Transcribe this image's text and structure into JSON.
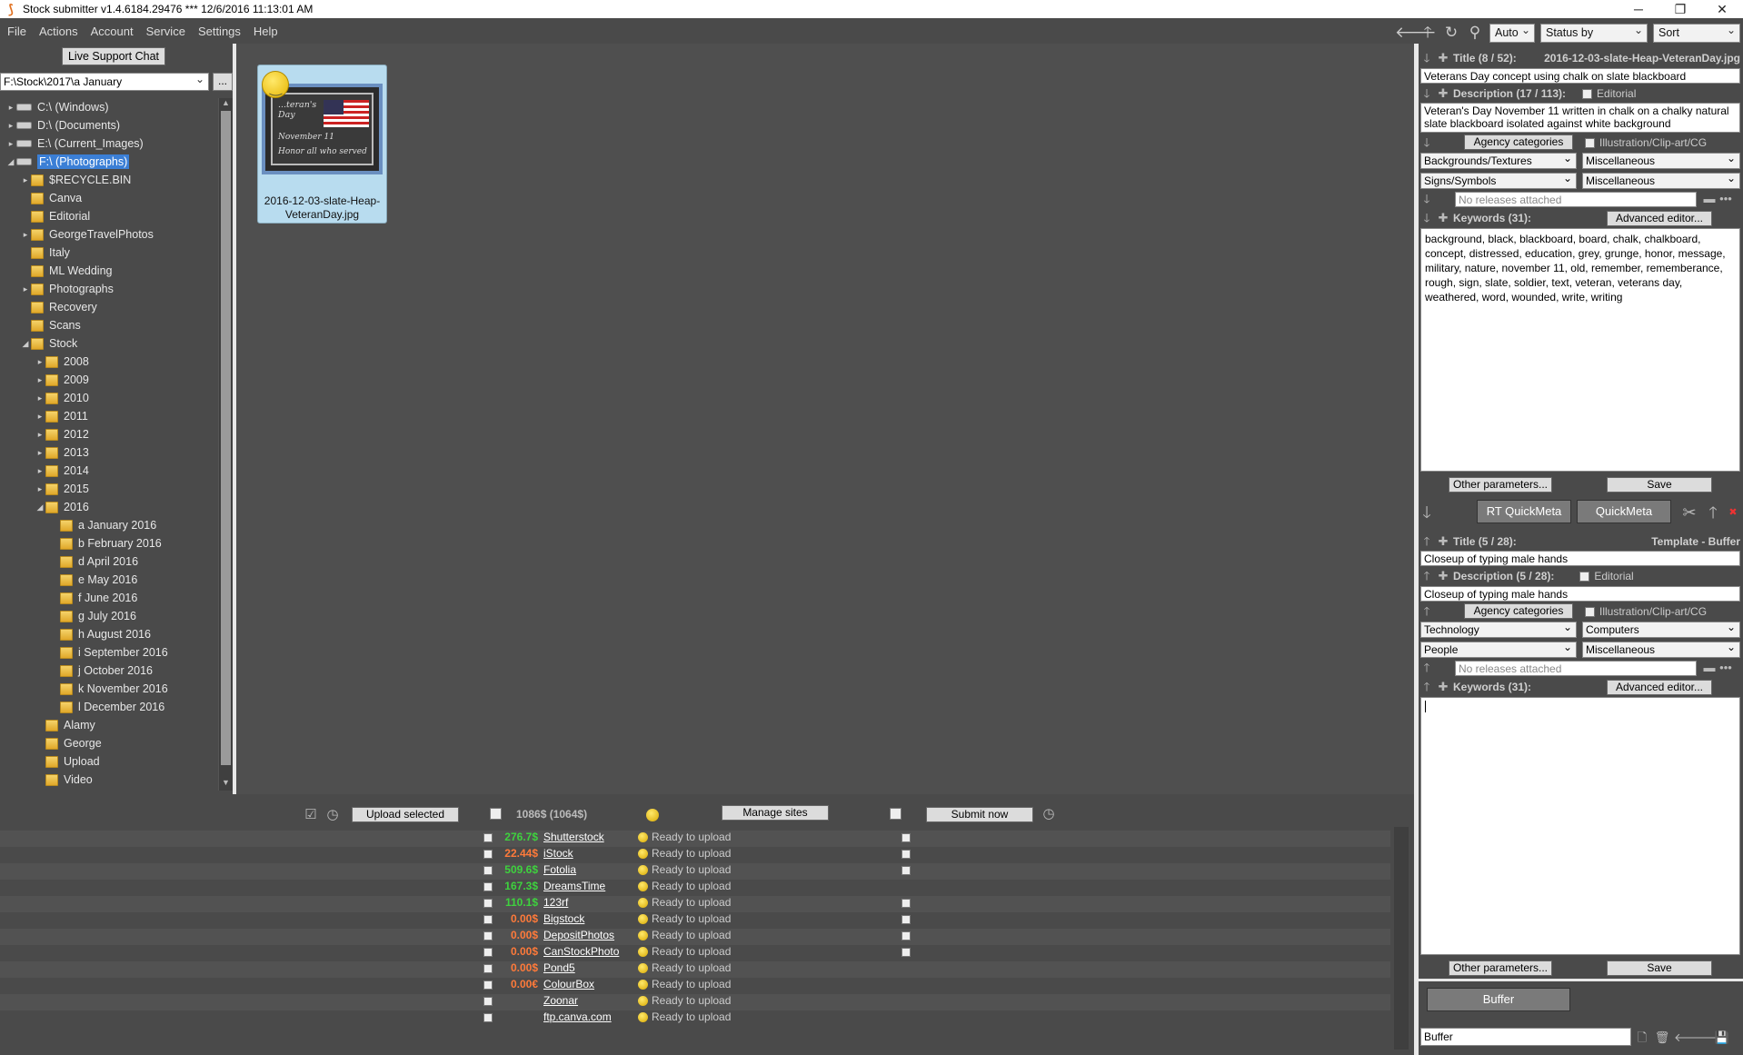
{
  "window": {
    "title": "Stock submitter v1.4.6184.29476 ***  12/6/2016 11:13:01 AM"
  },
  "menu": [
    "File",
    "Actions",
    "Account",
    "Service",
    "Settings",
    "Help"
  ],
  "toolbar": {
    "mode": "Auto",
    "status": "Status by agency",
    "sort": "Sort"
  },
  "left": {
    "live_chat": "Live Support Chat",
    "path": "F:\\Stock\\2017\\a January",
    "browse": "..."
  },
  "tree": [
    {
      "label": "C:\\ (Windows)",
      "type": "drive",
      "level": 0,
      "arrow": "▸"
    },
    {
      "label": "D:\\ (Documents)",
      "type": "drive",
      "level": 0,
      "arrow": "▸"
    },
    {
      "label": "E:\\ (Current_Images)",
      "type": "drive",
      "level": 0,
      "arrow": "▸"
    },
    {
      "label": "F:\\ (Photographs)",
      "type": "drive",
      "level": 0,
      "arrow": "◢",
      "selected": true
    },
    {
      "label": "$RECYCLE.BIN",
      "type": "folder",
      "level": 1,
      "arrow": "▸"
    },
    {
      "label": "Canva",
      "type": "folder",
      "level": 1,
      "arrow": ""
    },
    {
      "label": "Editorial",
      "type": "folder",
      "level": 1,
      "arrow": ""
    },
    {
      "label": "GeorgeTravelPhotos",
      "type": "folder",
      "level": 1,
      "arrow": "▸"
    },
    {
      "label": "Italy",
      "type": "folder",
      "level": 1,
      "arrow": ""
    },
    {
      "label": "ML Wedding",
      "type": "folder",
      "level": 1,
      "arrow": ""
    },
    {
      "label": "Photographs",
      "type": "folder",
      "level": 1,
      "arrow": "▸"
    },
    {
      "label": "Recovery",
      "type": "folder",
      "level": 1,
      "arrow": ""
    },
    {
      "label": "Scans",
      "type": "folder",
      "level": 1,
      "arrow": ""
    },
    {
      "label": "Stock",
      "type": "folder",
      "level": 1,
      "arrow": "◢"
    },
    {
      "label": "2008",
      "type": "folder",
      "level": 2,
      "arrow": "▸"
    },
    {
      "label": "2009",
      "type": "folder",
      "level": 2,
      "arrow": "▸"
    },
    {
      "label": "2010",
      "type": "folder",
      "level": 2,
      "arrow": "▸"
    },
    {
      "label": "2011",
      "type": "folder",
      "level": 2,
      "arrow": "▸"
    },
    {
      "label": "2012",
      "type": "folder",
      "level": 2,
      "arrow": "▸"
    },
    {
      "label": "2013",
      "type": "folder",
      "level": 2,
      "arrow": "▸"
    },
    {
      "label": "2014",
      "type": "folder",
      "level": 2,
      "arrow": "▸"
    },
    {
      "label": "2015",
      "type": "folder",
      "level": 2,
      "arrow": "▸"
    },
    {
      "label": "2016",
      "type": "folder",
      "level": 2,
      "arrow": "◢"
    },
    {
      "label": "a January 2016",
      "type": "folder",
      "level": 3,
      "arrow": ""
    },
    {
      "label": "b February 2016",
      "type": "folder",
      "level": 3,
      "arrow": ""
    },
    {
      "label": "d April 2016",
      "type": "folder",
      "level": 3,
      "arrow": ""
    },
    {
      "label": "e May 2016",
      "type": "folder",
      "level": 3,
      "arrow": ""
    },
    {
      "label": "f June 2016",
      "type": "folder",
      "level": 3,
      "arrow": ""
    },
    {
      "label": "g July 2016",
      "type": "folder",
      "level": 3,
      "arrow": ""
    },
    {
      "label": "h August 2016",
      "type": "folder",
      "level": 3,
      "arrow": ""
    },
    {
      "label": "i September 2016",
      "type": "folder",
      "level": 3,
      "arrow": ""
    },
    {
      "label": "j October 2016",
      "type": "folder",
      "level": 3,
      "arrow": ""
    },
    {
      "label": "k November 2016",
      "type": "folder",
      "level": 3,
      "arrow": ""
    },
    {
      "label": "l December 2016",
      "type": "folder",
      "level": 3,
      "arrow": ""
    },
    {
      "label": "Alamy",
      "type": "folder",
      "level": 2,
      "arrow": ""
    },
    {
      "label": "George",
      "type": "folder",
      "level": 2,
      "arrow": ""
    },
    {
      "label": "Upload",
      "type": "folder",
      "level": 2,
      "arrow": ""
    },
    {
      "label": "Video",
      "type": "folder",
      "level": 2,
      "arrow": ""
    }
  ],
  "thumbnail": {
    "filename": "2016-12-03-slate-Heap-VeteranDay.jpg",
    "image_text": {
      "line1": "...teran's",
      "line2": "Day",
      "line3": "November 11",
      "line4": "Honor all who served"
    }
  },
  "meta": {
    "title_label": "Title (8 / 52):",
    "title_file": "2016-12-03-slate-Heap-VeteranDay.jpg",
    "title_value": "Veterans Day concept using chalk on slate blackboard",
    "desc_label": "Description (17 / 113):",
    "editorial": "Editorial",
    "desc_value": "Veteran's Day November 11 written in chalk on a chalky natural slate blackboard isolated against white background",
    "agency_categories": "Agency categories",
    "illustration": "Illustration/Clip-art/CG",
    "cat1": "Backgrounds/Textures",
    "cat2": "Miscellaneous",
    "cat3": "Signs/Symbols",
    "cat4": "Miscellaneous",
    "releases_placeholder": "No releases attached",
    "keywords_label": "Keywords (31):",
    "advanced": "Advanced editor...",
    "keywords": "background, black, blackboard, board, chalk, chalkboard, concept, distressed, education, grey, grunge, honor, message, military, nature, november 11, old, remember, rememberance, rough, sign, slate, soldier, text, veteran, veterans day, weathered, word, wounded, write, writing",
    "other": "Other parameters...",
    "save": "Save"
  },
  "quickmeta": {
    "rt": "RT QuickMeta",
    "qm": "QuickMeta"
  },
  "template": {
    "title_label": "Title (5 / 28):",
    "template_name": "Template - Buffer",
    "title_value": "Closeup of typing male hands",
    "desc_label": "Description (5 / 28):",
    "editorial": "Editorial",
    "desc_value": "Closeup of typing male hands",
    "agency_categories": "Agency categories",
    "illustration": "Illustration/Clip-art/CG",
    "cat1": "Technology",
    "cat2": "Computers",
    "cat3": "People",
    "cat4": "Miscellaneous",
    "releases_placeholder": "No releases attached",
    "keywords_label": "Keywords (31):",
    "advanced": "Advanced editor...",
    "other": "Other parameters...",
    "save": "Save"
  },
  "buffer": {
    "button": "Buffer",
    "input": "Buffer"
  },
  "upload": {
    "upload_selected": "Upload selected",
    "total": "1086$  (1064$)",
    "manage_sites": "Manage sites",
    "submit_now": "Submit now"
  },
  "sites": [
    {
      "amount": "276.7$",
      "color": "#3ed23e",
      "name": "Shutterstock",
      "status": "Ready to upload",
      "check2": true
    },
    {
      "amount": "22.44$",
      "color": "#ff7a3a",
      "name": "iStock",
      "status": "Ready to upload",
      "check2": true
    },
    {
      "amount": "509.6$",
      "color": "#3ed23e",
      "name": "Fotolia",
      "status": "Ready to upload",
      "check2": true
    },
    {
      "amount": "167.3$",
      "color": "#3ed23e",
      "name": "DreamsTime",
      "status": "Ready to upload",
      "check2": false
    },
    {
      "amount": "110.1$",
      "color": "#3ed23e",
      "name": "123rf",
      "status": "Ready to upload",
      "check2": true
    },
    {
      "amount": "0.00$",
      "color": "#ff7a3a",
      "name": "Bigstock",
      "status": "Ready to upload",
      "check2": true
    },
    {
      "amount": "0.00$",
      "color": "#ff7a3a",
      "name": "DepositPhotos",
      "status": "Ready to upload",
      "check2": true
    },
    {
      "amount": "0.00$",
      "color": "#ff7a3a",
      "name": "CanStockPhoto",
      "status": "Ready to upload",
      "check2": true
    },
    {
      "amount": "0.00$",
      "color": "#ff7a3a",
      "name": "Pond5",
      "status": "Ready to upload",
      "check2": false
    },
    {
      "amount": "0.00€",
      "color": "#ff7a3a",
      "name": "ColourBox",
      "status": "Ready to upload",
      "check2": false
    },
    {
      "amount": "",
      "color": "#ff7a3a",
      "name": "Zoonar",
      "status": "Ready to upload",
      "check2": false
    },
    {
      "amount": "",
      "color": "#ff7a3a",
      "name": "ftp.canva.com",
      "status": "Ready to upload",
      "check2": false
    }
  ]
}
